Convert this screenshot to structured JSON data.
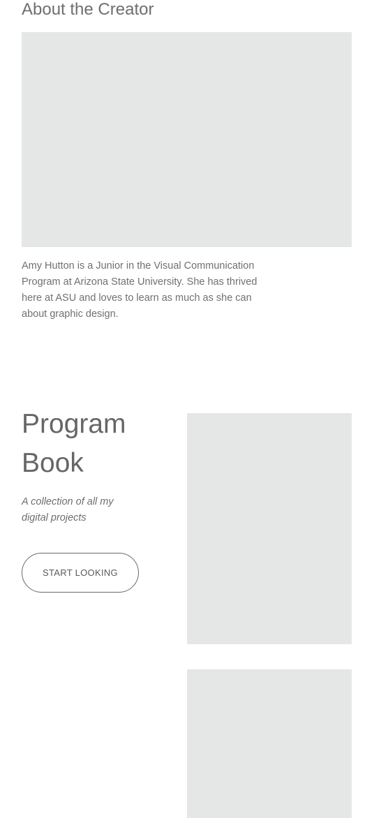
{
  "about": {
    "heading": "About the Creator",
    "bio": "Amy Hutton is a Junior in the Visual Communication Program at Arizona State University. She has thrived here at ASU and loves to learn as much as she can about graphic design."
  },
  "program_book": {
    "title": "Program Book",
    "subtitle": "A collection of all my digital projects",
    "button_label": "START LOOKING"
  },
  "colors": {
    "placeholder": "#e5e6e6",
    "text": "#6e6e6e",
    "button_border": "#6a6a6a"
  }
}
